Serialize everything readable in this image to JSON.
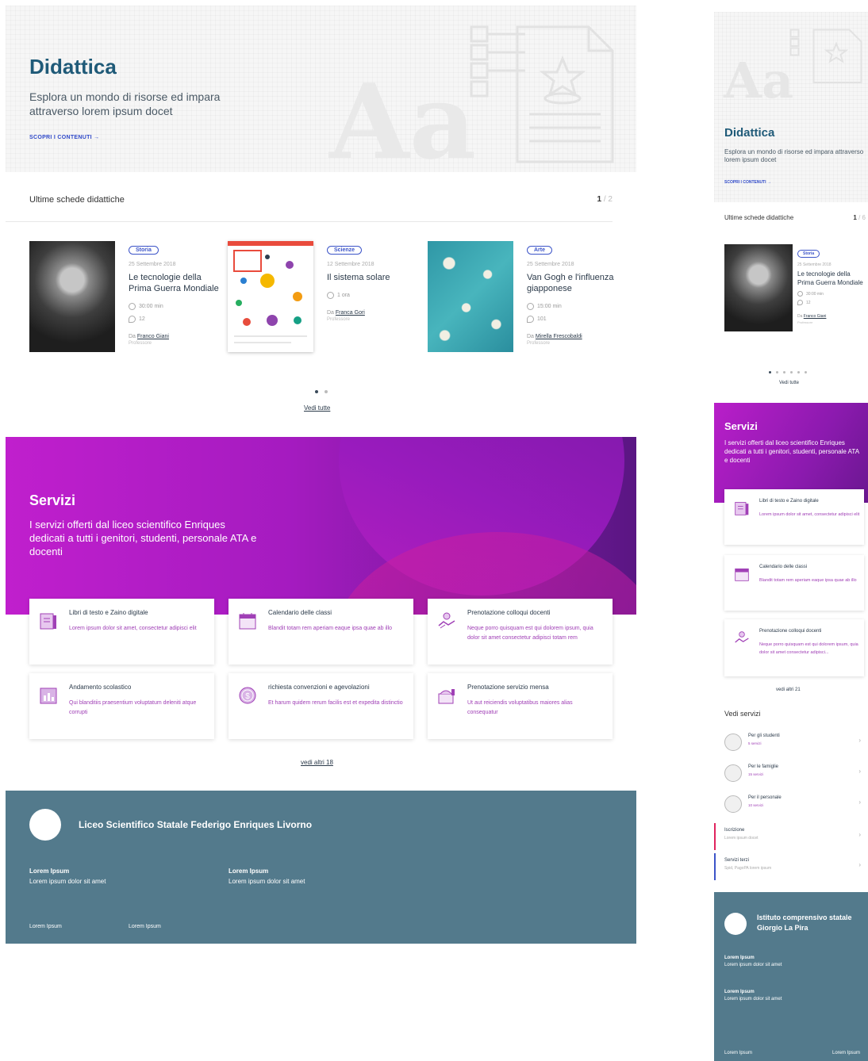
{
  "desktop": {
    "hero": {
      "title": "Didattica",
      "subtitle": "Esplora un mondo di risorse ed impara attraverso lorem ipsum docet",
      "cta": "SCOPRI I CONTENUTI →",
      "watermark": "Aa"
    },
    "latest": {
      "title": "Ultime schede didattiche",
      "page_current": "1",
      "page_total": " / 2"
    },
    "cards": [
      {
        "tag": "Storia",
        "date": "25 Settembre 2018",
        "title": "Le tecnologie della Prima Guerra Mondiale",
        "meta1": "30:00 min",
        "meta2": "12",
        "author_prefix": "Da ",
        "author": "Franco Giani",
        "role": "Professore"
      },
      {
        "tag": "Scienze",
        "date": "12 Settembre 2018",
        "title": "Il sistema solare",
        "meta1": "1 ora",
        "author_prefix": "Da ",
        "author": "Franca Gori",
        "role": "Professore"
      },
      {
        "tag": "Arte",
        "date": "25 Settembre 2018",
        "title": "Van Gogh e l'influenza giapponese",
        "meta1": "15:00 min",
        "meta2": "101",
        "author_prefix": "Da ",
        "author": "Mirella Frescobaldi",
        "role": "Professore"
      }
    ],
    "carousel": {
      "pages": 2,
      "active": 1
    },
    "see_all": "Vedi tutte",
    "services": {
      "title": "Servizi",
      "subtitle": "I servizi offerti dal liceo scientifico Enriques dedicati a tutti i genitori, studenti, personale ATA e docenti",
      "items": [
        {
          "title": "Libri di testo e Zaino digitale",
          "desc": "Lorem ipsum dolor sit amet, consectetur adipisci elit",
          "icon": "book-icon"
        },
        {
          "title": "Calendario delle classi",
          "desc": "Blandit totam rem aperiam eaque ipsa quae ab illo",
          "icon": "calendar-icon"
        },
        {
          "title": "Prenotazione colloqui docenti",
          "desc": "Neque porro quisquam est qui dolorem ipsum, quia dolor sit amet consectetur adipisci totam rem",
          "icon": "handshake-icon"
        },
        {
          "title": "Andamento scolastico",
          "desc": "Qui blanditiis praesentium voluptatum deleniti atque corrupti",
          "icon": "chart-icon"
        },
        {
          "title": "richiesta convenzioni e agevolazioni",
          "desc": "Et harum quidem rerum facilis est et expedita distinctio",
          "icon": "coin-icon"
        },
        {
          "title": "Prenotazione servizio mensa",
          "desc": "Ut aut reiciendis voluptatibus maiores alias consequatur",
          "icon": "food-tray-icon"
        }
      ],
      "more": "vedi altri 18"
    },
    "footer": {
      "school": "Liceo Scientifico Statale Federigo Enriques Livorno",
      "col1_title": "Lorem Ipsum",
      "col1_text": "Lorem ipsum dolor sit amet",
      "col2_title": "Lorem Ipsum",
      "col2_text": "Lorem ipsum dolor sit amet",
      "link1": "Lorem Ipsum",
      "link2": "Lorem Ipsum"
    }
  },
  "mobile": {
    "hero": {
      "title": "Didattica",
      "subtitle": "Esplora un mondo di risorse ed impara attraverso lorem ipsum docet",
      "cta": "SCOPRI I CONTENUTI →",
      "watermark": "Aa"
    },
    "latest": {
      "title": "Ultime schede didattiche",
      "page_current": "1",
      "page_total": " / 6"
    },
    "card": {
      "tag": "Storia",
      "date": "25 Settembre 2018",
      "title": "Le tecnologie della Prima Guerra Mondiale",
      "meta1": "30:00 min",
      "meta2": "12",
      "author_prefix": "Da ",
      "author": "Franco Giani",
      "role": "Professore"
    },
    "carousel": {
      "pages": 6,
      "active": 1
    },
    "see_all": "Vedi tutte",
    "services": {
      "title": "Servizi",
      "subtitle": "I servizi offerti dal liceo scientifico Enriques dedicati a tutti i genitori, studenti, personale ATA e docenti",
      "items": [
        {
          "title": "Libri di testo e Zaino digitale",
          "desc": "Lorem ipsum dolor sit amet, consectetur adipisci elit"
        },
        {
          "title": "Calendario delle classi",
          "desc": "Blandit totam rem aperiam eaque ipsa quae ab illo"
        },
        {
          "title": "Prenotazione colloqui docenti",
          "desc": "Neque porro quisquam est qui dolorem ipsum, quia dolor sit amet consectetur adipisci..."
        }
      ],
      "more": "vedi altri 21"
    },
    "see_services": "Vedi servizi",
    "audiences": [
      {
        "title": "Per gli studenti",
        "count": "5 servizi"
      },
      {
        "title": "Per le famiglie",
        "count": "15 servizi"
      },
      {
        "title": "Per il personale",
        "count": "10 servizi"
      }
    ],
    "links": [
      {
        "title": "Iscrizione",
        "sub": "Lorem ipsum docet",
        "color": "#e0245e"
      },
      {
        "title": "Servizi terzi",
        "sub": "Spid, PagoPA lorem ipsum",
        "color": "#3c54c8"
      }
    ],
    "footer": {
      "school": "Istituto comprensivo statale Giorgio La Pira",
      "col1_title": "Lorem Ipsum",
      "col1_text": "Lorem ipsum dolor sit amet",
      "col2_title": "Lorem Ipsum",
      "col2_text": "Lorem ipsum dolor sit amet",
      "link1": "Lorem Ipsum",
      "link2": "Lorem Ipsum"
    }
  },
  "colors": {
    "primary": "#1f5a78",
    "accent": "#3c54c8",
    "services": "#a51bc0",
    "footer": "#537a8c"
  }
}
